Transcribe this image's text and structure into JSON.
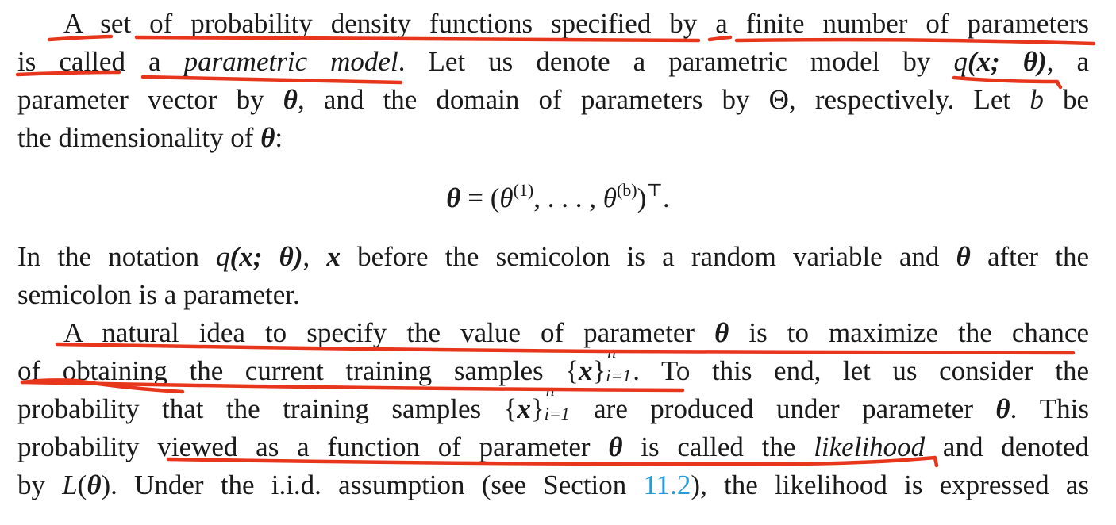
{
  "paragraph1": {
    "line1": [
      "A set of probability density functions specified by a finite number of parameters"
    ],
    "line2_a": "is called a ",
    "line2_em": "parametric model",
    "line2_b": ". Let us denote a parametric model by ",
    "line2_q": "q",
    "line2_args": "(x; θ)",
    "line2_c": ", a",
    "line3_a": "parameter vector by ",
    "line3_theta": "θ",
    "line3_b": ", and the domain of parameters by Θ, respectively. Let ",
    "line3_bvar": "b",
    "line3_c": " be",
    "line4_a": "the dimensionality of ",
    "line4_theta": "θ",
    "line4_b": ":"
  },
  "equation": {
    "lhs": "θ",
    "eq": " = (",
    "theta1": "θ",
    "sup1": "(1)",
    "mid": ", . . . , ",
    "theta2": "θ",
    "sup2": "(b)",
    "close": ")",
    "transpose": "⊤",
    "end": "."
  },
  "paragraph2": {
    "line1_a": "In the notation ",
    "line1_q": "q",
    "line1_args": "(x; θ)",
    "line1_b": ", ",
    "line1_x": "x",
    "line1_c": " before the semicolon is a random variable and ",
    "line1_theta": "θ",
    "line1_d": " after the",
    "line2": "semicolon is a parameter."
  },
  "paragraph3": {
    "line1_a": "A natural idea to specify the value of parameter ",
    "line1_theta": "θ",
    "line1_b": " is to maximize the chance",
    "line2_a": "of obtaining the current training samples {",
    "line2_x": "x",
    "line2_b": "}",
    "line2_sup": "n",
    "line2_sub": "i=1",
    "line2_c": ". To this end, let us consider the",
    "line3_a": "probability that the training samples {",
    "line3_x": "x",
    "line3_b": "}",
    "line3_sup": "n",
    "line3_sub": "i=1",
    "line3_c": " are produced under parameter ",
    "line3_theta": "θ",
    "line3_d": ". This",
    "line4_a": "probability viewed as a function of parameter ",
    "line4_theta": "θ",
    "line4_b": " is called the ",
    "line4_em": "likelihood",
    "line4_c": " and denoted",
    "line5_a": "by ",
    "line5_L": "L",
    "line5_b": "(",
    "line5_theta": "θ",
    "line5_c": "). Under the i.i.d. assumption (see Section ",
    "line5_link": "11.2",
    "line5_d": "), the likelihood is expressed as"
  },
  "colors": {
    "annotation_pen": "#e8361c",
    "link": "#2a9bd6",
    "text": "#1a1a1a"
  }
}
